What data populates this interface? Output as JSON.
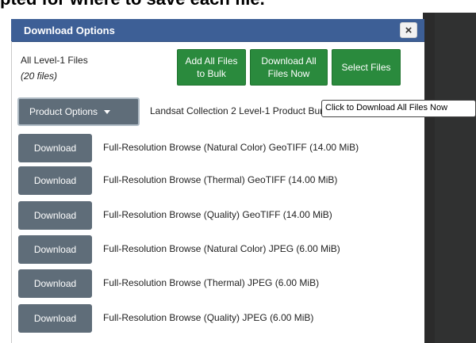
{
  "page": {
    "top_text": "pted for where to save each file."
  },
  "dialog": {
    "title": "Download Options",
    "close_glyph": "×",
    "summary_label": "All Level-1 Files",
    "summary_count": "(20 files)",
    "add_bulk_line1": "Add All Files",
    "add_bulk_line2": "to Bulk",
    "download_all_line1": "Download All",
    "download_all_line2": "Files Now",
    "select_files": "Select Files",
    "product_options": "Product Options",
    "product_label": "Landsat Collection 2 Level-1 Product Bundle",
    "tooltip": "Click to Download All Files Now",
    "download_label": "Download",
    "files": [
      {
        "label": "Full-Resolution Browse (Natural Color) GeoTIFF (14.00 MiB)"
      },
      {
        "label": "Full-Resolution Browse (Thermal) GeoTIFF (14.00 MiB)"
      },
      {
        "label": "Full-Resolution Browse (Quality) GeoTIFF (14.00 MiB)"
      },
      {
        "label": "Full-Resolution Browse (Natural Color) JPEG (6.00 MiB)"
      },
      {
        "label": "Full-Resolution Browse (Thermal) JPEG (6.00 MiB)"
      },
      {
        "label": "Full-Resolution Browse (Quality) JPEG (6.00 MiB)"
      }
    ]
  },
  "colors": {
    "titlebar": "#3d5f96",
    "green_button": "#2a8a3d",
    "gray_button": "#5f6d79"
  }
}
